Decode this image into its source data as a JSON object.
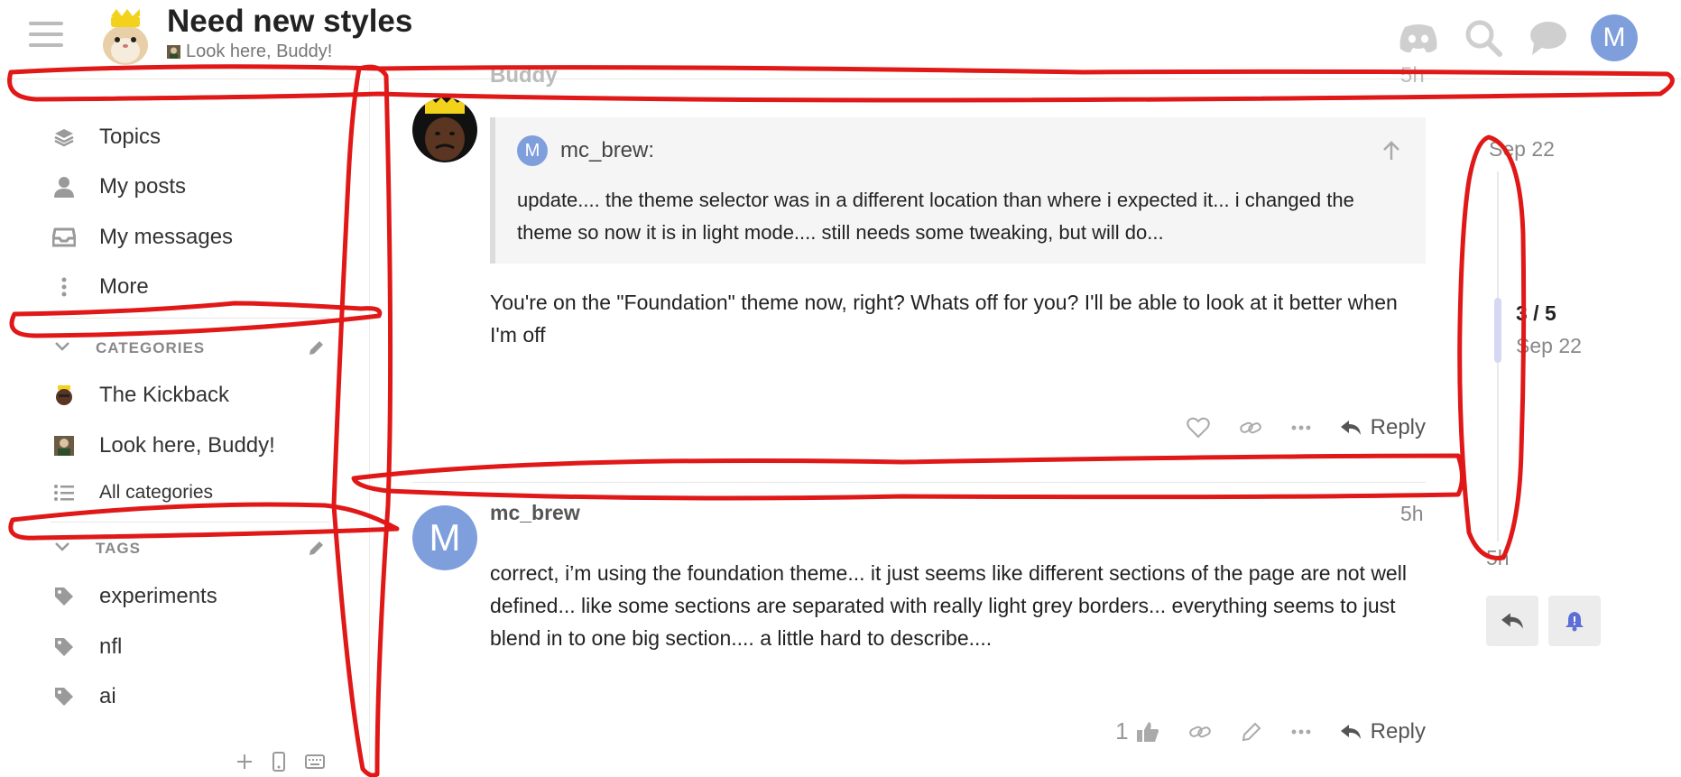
{
  "header": {
    "title": "Need new styles",
    "category": "Look here, Buddy!",
    "avatar_letter": "M",
    "icons": [
      "discord-icon",
      "search-icon",
      "chat-icon"
    ]
  },
  "sidebar": {
    "nav": [
      {
        "label": "Topics",
        "icon": "layers-icon"
      },
      {
        "label": "My posts",
        "icon": "user-icon"
      },
      {
        "label": "My messages",
        "icon": "inbox-icon"
      },
      {
        "label": "More",
        "icon": "vertical-ellipsis-icon"
      }
    ],
    "categories_heading": "CATEGORIES",
    "categories": [
      {
        "label": "The Kickback"
      },
      {
        "label": "Look here, Buddy!"
      },
      {
        "label": "All categories"
      }
    ],
    "tags_heading": "TAGS",
    "tags": [
      {
        "label": "experiments"
      },
      {
        "label": "nfl"
      },
      {
        "label": "ai"
      }
    ]
  },
  "posts": {
    "ghost_user": "Buddy",
    "ghost_date": "5h",
    "reply_post": {
      "quote_user": "mc_brew:",
      "quote_avatar_letter": "M",
      "quote_text": "update.... the theme selector was in a different location than where i expected it... i changed the theme so now it is in light mode.... still needs some tweaking, but will do...",
      "body": "You're on the \"Foundation\" theme now, right? Whats off for you? I'll be able to look at it better when I'm off",
      "reply_label": "Reply"
    },
    "mc_post": {
      "username": "mc_brew",
      "avatar_letter": "M",
      "date": "5h",
      "body": "correct, i’m using the foundation theme... it just seems like different sections of the page are not well defined... like some sections are separated with really light grey borders... everything seems to just blend in to one big section.... a little hard to describe....",
      "like_count": "1",
      "reply_label": "Reply"
    }
  },
  "timeline": {
    "start_date": "Sep 22",
    "progress": "3 / 5",
    "current_date": "Sep 22",
    "end_date": "5h"
  },
  "colors": {
    "accent": "#7f9fdc",
    "annotation": "#e01818",
    "notify_bell": "#5b6fd6"
  }
}
